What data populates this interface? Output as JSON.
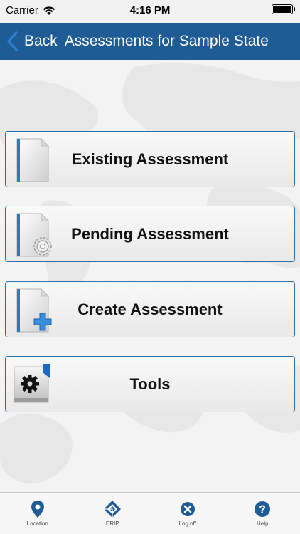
{
  "status_bar": {
    "carrier": "Carrier",
    "time": "4:16 PM",
    "battery_percent": 100
  },
  "nav_bar": {
    "back_label": "Back",
    "title": "Assessments for Sample State",
    "bar_color": "#1f5b94"
  },
  "menu": {
    "items": [
      {
        "label": "Existing Assessment",
        "icon": "document-icon"
      },
      {
        "label": "Pending Assessment",
        "icon": "document-gear-icon"
      },
      {
        "label": "Create Assessment",
        "icon": "document-plus-icon"
      },
      {
        "label": "Tools",
        "icon": "tools-gear-icon"
      }
    ],
    "border_color": "#2d6ea6"
  },
  "tab_bar": {
    "items": [
      {
        "label": "Location",
        "icon": "location-pin-icon"
      },
      {
        "label": "ERIP",
        "icon": "erip-logo-icon"
      },
      {
        "label": "Log off",
        "icon": "logoff-x-icon"
      },
      {
        "label": "Help",
        "icon": "help-question-icon"
      }
    ],
    "icon_color": "#1f5b94"
  }
}
